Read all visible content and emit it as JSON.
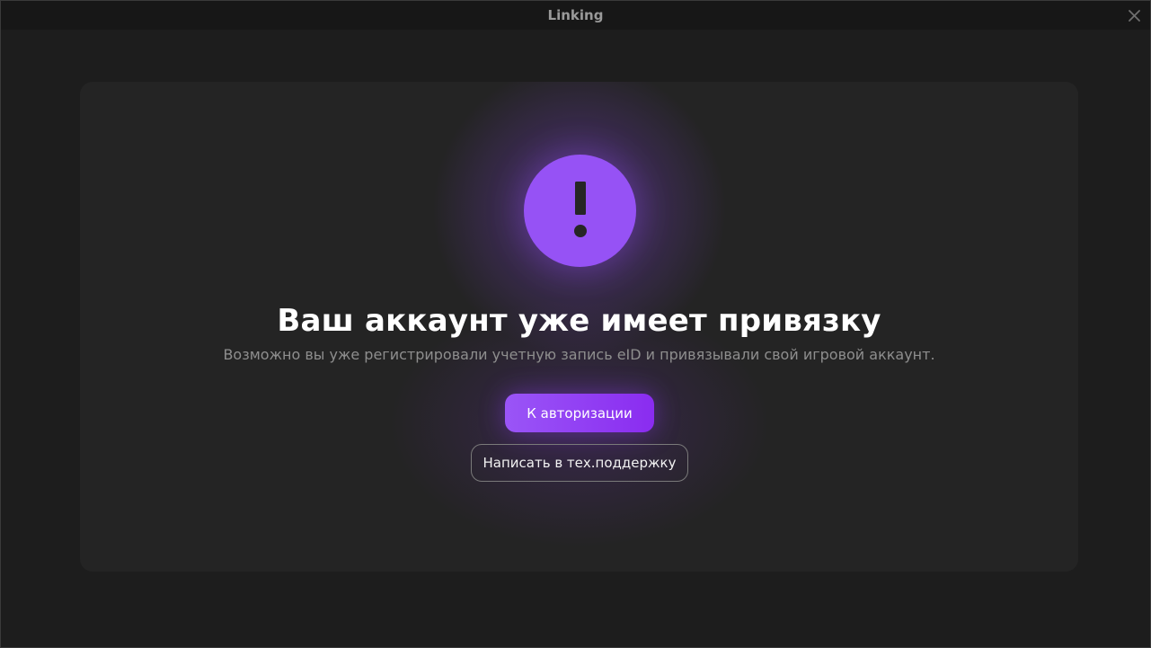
{
  "window": {
    "title": "Linking",
    "close_icon": "close-icon"
  },
  "dialog": {
    "icon": "exclamation-circle-icon",
    "accent_color": "#9652f5",
    "heading": "Ваш аккаунт уже имеет привязку",
    "message": "Возможно вы уже регистрировали учетную запись eID и привязывали свой игровой аккаунт.",
    "primary_button_label": "К авторизации",
    "secondary_button_label": "Написать в тех.поддержку"
  }
}
